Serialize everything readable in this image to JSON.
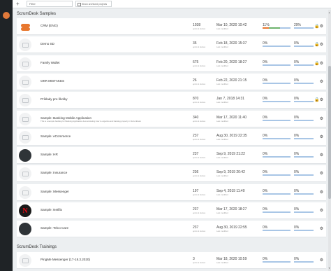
{
  "toolbar": {
    "filter_placeholder": "Filter",
    "archived_label": "Show archived projects"
  },
  "sections": [
    {
      "title": "ScrumDesk Samples",
      "projects": [
        {
          "name": "CRM (ENG)",
          "sub": "",
          "thumb": "orange",
          "count": "1038",
          "count_label": "epics & stories",
          "date": "Mar 10, 2020 10:42",
          "date_label": "Last modified",
          "p1": "11%",
          "p2": "29%",
          "action": "🔒⚙"
        },
        {
          "name": "Demo SD",
          "sub": "",
          "thumb": "folder",
          "count": "35",
          "count_label": "epics & stories",
          "date": "Feb 18, 2020 15:37",
          "date_label": "Last modified",
          "p1": "0%",
          "p2": "0%",
          "action": "🔒⚙"
        },
        {
          "name": "Family Wallet",
          "sub": "",
          "thumb": "folder",
          "count": "675",
          "count_label": "epics & stories",
          "date": "Feb 20, 2020 18:27",
          "date_label": "Last modified",
          "p1": "0%",
          "p2": "0%",
          "action": "🔒⚙"
        },
        {
          "name": "OKR MISTAKES",
          "sub": "",
          "thumb": "folder",
          "count": "26",
          "count_label": "epics & stories",
          "date": "Feb 22, 2020 21:15",
          "date_label": "Last modified",
          "p1": "0%",
          "p2": "0%",
          "action": "⚙"
        },
        {
          "name": "Príklady pre školky",
          "sub": "",
          "thumb": "folder",
          "count": "870",
          "count_label": "epics & stories",
          "date": "Jan 7, 2018 14:31",
          "date_label": "Last modified",
          "p1": "0%",
          "p2": "0%",
          "action": "🔒⚙"
        },
        {
          "name": "Sample: Banking Mobile Application",
          "sub": "This is a sample backlog for Banking Application demonstrating how to organize and backlog properly in ScrumDesk",
          "thumb": "folder",
          "count": "340",
          "count_label": "epics & stories",
          "date": "Mar 17, 2020 11:40",
          "date_label": "Last modified",
          "p1": "0%",
          "p2": "0%",
          "action": "⚙"
        },
        {
          "name": "Sample: eCommerce",
          "sub": "",
          "thumb": "folder",
          "count": "237",
          "count_label": "epics & stories",
          "date": "Aug 30, 2019 22:35",
          "date_label": "Last modified",
          "p1": "0%",
          "p2": "0%",
          "action": "⚙"
        },
        {
          "name": "Sample: HR",
          "sub": "",
          "thumb": "dark",
          "count": "237",
          "count_label": "epics & stories",
          "date": "Sep 9, 2019 21:22",
          "date_label": "Last modified",
          "p1": "0%",
          "p2": "0%",
          "action": "⚙"
        },
        {
          "name": "Sample: Insurance",
          "sub": "",
          "thumb": "folder",
          "count": "236",
          "count_label": "epics & stories",
          "date": "Sep 9, 2019 20:42",
          "date_label": "Last modified",
          "p1": "0%",
          "p2": "0%",
          "action": "⚙"
        },
        {
          "name": "Sample: Messenger",
          "sub": "",
          "thumb": "folder",
          "count": "197",
          "count_label": "epics & stories",
          "date": "Sep 4, 2019 11:40",
          "date_label": "Last modified",
          "p1": "0%",
          "p2": "0%",
          "action": "⚙"
        },
        {
          "name": "Sample: Netflix",
          "sub": "",
          "thumb": "red",
          "count": "237",
          "count_label": "epics & stories",
          "date": "Mar 17, 2020 18:27",
          "date_label": "Last modified",
          "p1": "0%",
          "p2": "0%",
          "action": "⚙"
        },
        {
          "name": "Sample: Telco Care",
          "sub": "",
          "thumb": "dark",
          "count": "237",
          "count_label": "epics & stories",
          "date": "Aug 30, 2019 22:55",
          "date_label": "Last modified",
          "p1": "0%",
          "p2": "0%",
          "action": "⚙"
        }
      ]
    },
    {
      "title": "ScrumDesk Trainings",
      "projects": [
        {
          "name": "PingMe Messenger (17-18.3.2020)",
          "sub": "",
          "thumb": "folder",
          "count": "3",
          "count_label": "epics & stories",
          "date": "Mar 18, 2020 10:59",
          "date_label": "Last modified",
          "p1": "0%",
          "p2": "0%",
          "action": "⚙"
        }
      ]
    }
  ],
  "colors": {
    "sidebar": "#1f2326",
    "progress_blue": "#a9c6e6",
    "accent_orange": "#e8772e"
  }
}
